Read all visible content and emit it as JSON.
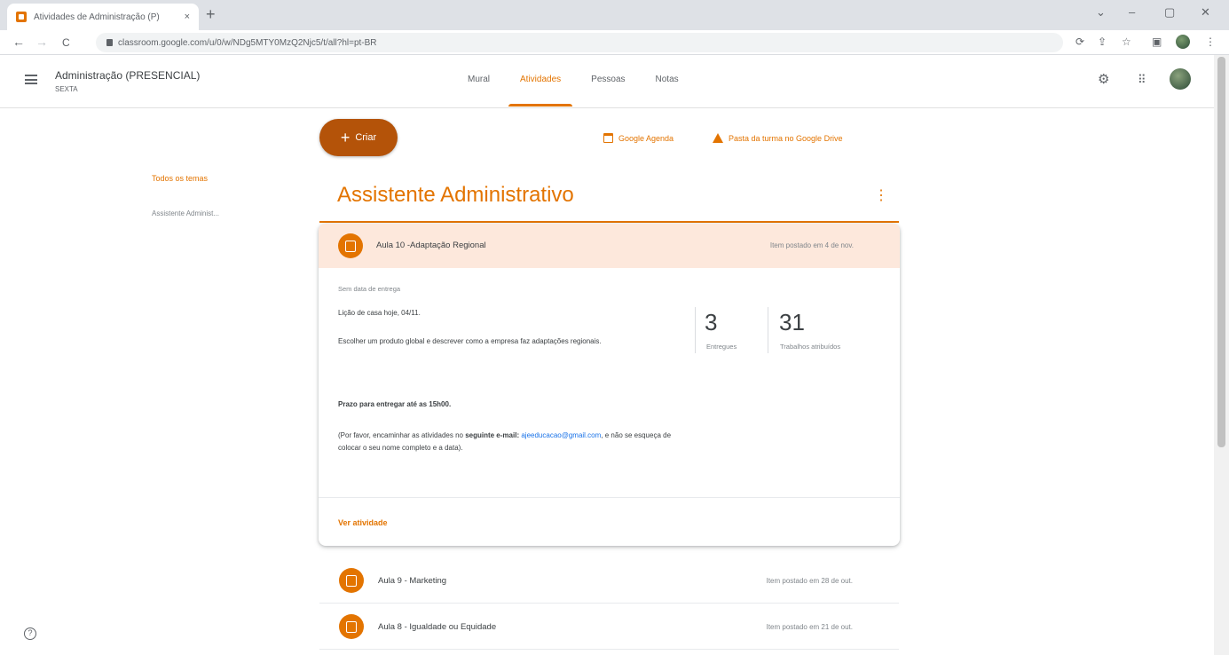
{
  "browser": {
    "tab_title": "Atividades de Administração (P)",
    "tab_close": "×",
    "new_tab": "+",
    "url": "classroom.google.com/u/0/w/NDg5MTY0MzQ2Njc5/t/all?hl=pt-BR",
    "minimize": "⌄",
    "restore": "–",
    "maximize": "▢",
    "close": "✕",
    "back": "←",
    "forward": "→",
    "reload": "C"
  },
  "header": {
    "class_name": "Administração (PRESENCIAL)",
    "class_section": "SEXTA",
    "tabs": [
      {
        "label": "Mural"
      },
      {
        "label": "Atividades"
      },
      {
        "label": "Pessoas"
      },
      {
        "label": "Notas"
      }
    ],
    "active_tab": "Atividades"
  },
  "sidebar": {
    "topics": [
      {
        "label": "Todos os temas"
      },
      {
        "label": "Assistente Administ..."
      }
    ]
  },
  "toolbar": {
    "create_label": "Criar",
    "calendar_label": "Google Agenda",
    "drive_label": "Pasta da turma no Google Drive"
  },
  "topic": {
    "title": "Assistente Administrativo",
    "expanded": {
      "title": "Aula 10 -Adaptação Regional",
      "posted": "Item postado em 4 de nov.",
      "due": "Sem data de entrega",
      "line1": "Lição de casa hoje, 04/11.",
      "line2": "Escolher um produto global e descrever como a empresa faz adaptações regionais.",
      "deadline": "Prazo para entregar até as 15h00.",
      "email_pre": "(Por favor, encaminhar as atividades no ",
      "email_bold": "seguinte e-mail",
      "email_colon": ":",
      "email_link": "ajeeducacao@gmail.com",
      "email_post": ", e não se esqueça de colocar o seu nome completo e a data).",
      "stats": {
        "handed_in": "3",
        "handed_in_label": "Entregues",
        "assigned": "31",
        "assigned_label": "Trabalhos atribuídos"
      },
      "view_label": "Ver atividade"
    },
    "items": [
      {
        "title": "Aula 9 - Marketing",
        "posted": "Item postado em 28 de out."
      },
      {
        "title": "Aula 8 - Igualdade ou Equidade",
        "posted": "Item postado em 21 de out."
      }
    ]
  },
  "colors": {
    "accent": "#e37400",
    "create_button": "#b45309",
    "card_header": "#fde8dc"
  },
  "icons": [
    "menu-icon",
    "settings-icon",
    "apps-icon",
    "calendar-icon",
    "drive-icon",
    "assignment-icon",
    "more-vert-icon",
    "help-icon"
  ]
}
